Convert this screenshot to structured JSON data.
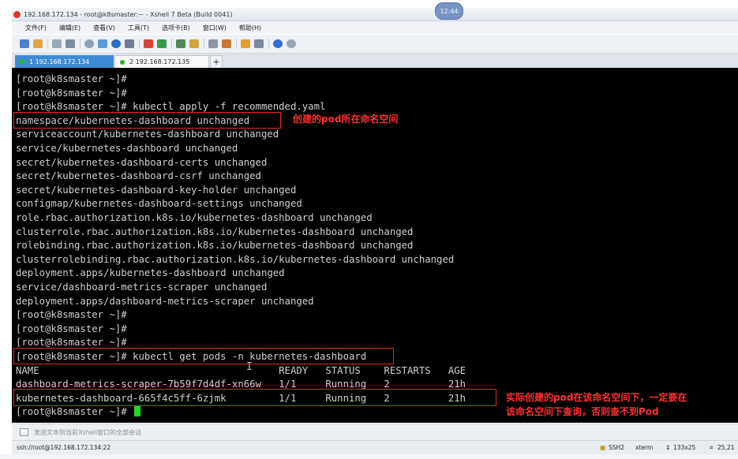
{
  "window": {
    "title": "192.168.172.134 - root@k8smaster:~ - Xshell 7 Beta (Build 0041)",
    "clock": "12:44"
  },
  "menu": [
    "文件(F)",
    "编辑(E)",
    "查看(V)",
    "工具(T)",
    "选项卡(B)",
    "窗口(W)",
    "帮助(H)"
  ],
  "toolbar_icons": [
    "new-session-icon",
    "open-folder-icon",
    "reconnect-icon",
    "properties-icon",
    "find-icon",
    "transfer-icon",
    "color-scheme-icon",
    "font-icon",
    "xftp-icon",
    "xagent-icon",
    "fullscreen-icon",
    "lock-icon",
    "keyboard-icon",
    "script-icon",
    "compose-icon",
    "layout-icon",
    "help-icon",
    "chat-icon"
  ],
  "tabs": [
    {
      "label": "1 192.168.172.134",
      "active": true
    },
    {
      "label": "2 192.168.172.135",
      "active": false
    }
  ],
  "tab_add": "+",
  "terminal": {
    "lines": [
      "[root@k8smaster ~]#",
      "[root@k8smaster ~]#",
      "[root@k8smaster ~]# kubectl apply -f recommended.yaml",
      "namespace/kubernetes-dashboard unchanged",
      "serviceaccount/kubernetes-dashboard unchanged",
      "service/kubernetes-dashboard unchanged",
      "secret/kubernetes-dashboard-certs unchanged",
      "secret/kubernetes-dashboard-csrf unchanged",
      "secret/kubernetes-dashboard-key-holder unchanged",
      "configmap/kubernetes-dashboard-settings unchanged",
      "role.rbac.authorization.k8s.io/kubernetes-dashboard unchanged",
      "clusterrole.rbac.authorization.k8s.io/kubernetes-dashboard unchanged",
      "rolebinding.rbac.authorization.k8s.io/kubernetes-dashboard unchanged",
      "clusterrolebinding.rbac.authorization.k8s.io/kubernetes-dashboard unchanged",
      "deployment.apps/kubernetes-dashboard unchanged",
      "service/dashboard-metrics-scraper unchanged",
      "deployment.apps/dashboard-metrics-scraper unchanged",
      "[root@k8smaster ~]#",
      "[root@k8smaster ~]#",
      "[root@k8smaster ~]#",
      "[root@k8smaster ~]# kubectl get pods -n kubernetes-dashboard",
      "NAME                                         READY   STATUS    RESTARTS   AGE",
      "dashboard-metrics-scraper-7b59f7d4df-xn66w   1/1     Running   2          21h",
      "kubernetes-dashboard-665f4c5ff-6zjmk         1/1     Running   2          21h",
      "[root@k8smaster ~]#"
    ],
    "cursor_color": "#21d821"
  },
  "annotations": {
    "namespace_note": "创建的pod所在命名空间",
    "pod_note_line1": "实际创建的pod在该命名空间下，一定要在",
    "pod_note_line2": "该命名空间下查询，否则查不到Pod",
    "color": "#e02a2a"
  },
  "sendbar": {
    "text": "发送文本到当前Xshell窗口的全部会话"
  },
  "status": {
    "connection": "ssh://root@192.168.172.134:22",
    "protocol": "SSH2",
    "term": "xterm",
    "size": "133x25",
    "cursor": "25,21"
  }
}
